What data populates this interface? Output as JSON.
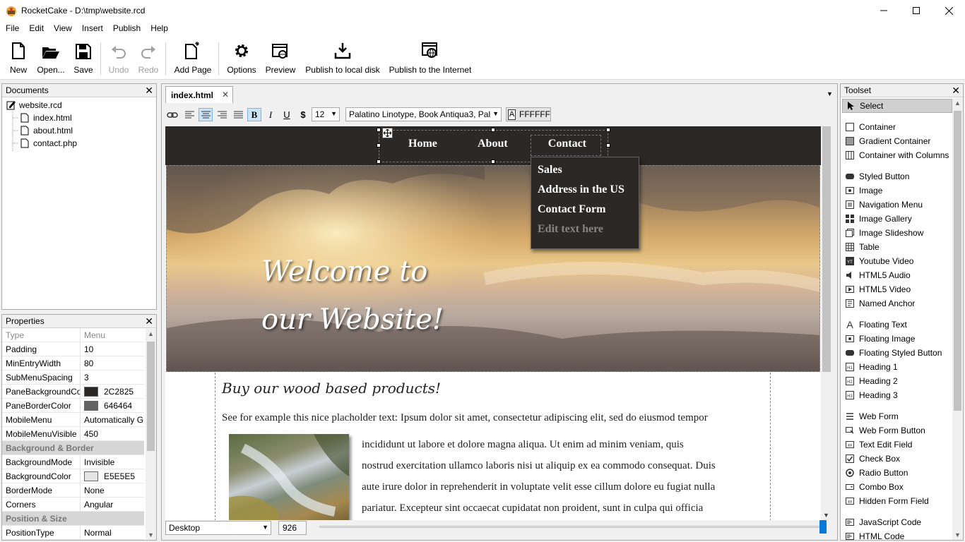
{
  "window": {
    "title": "RocketCake - D:\\tmp\\website.rcd",
    "minimize": "—",
    "maximize": "☐",
    "close": "✕"
  },
  "menu": [
    "File",
    "Edit",
    "View",
    "Insert",
    "Publish",
    "Help"
  ],
  "toolbar": {
    "new": "New",
    "open": "Open...",
    "save": "Save",
    "undo": "Undo",
    "redo": "Redo",
    "add_page": "Add Page",
    "options": "Options",
    "preview": "Preview",
    "publish_local": "Publish to local disk",
    "publish_internet": "Publish to the Internet"
  },
  "documents": {
    "title": "Documents",
    "close": "✕",
    "root": "website.rcd",
    "files": [
      "index.html",
      "about.html",
      "contact.php"
    ]
  },
  "properties": {
    "title": "Properties",
    "close": "✕",
    "rows": [
      {
        "k": "Type",
        "v": "Menu"
      },
      {
        "k": "Padding",
        "v": "10"
      },
      {
        "k": "MinEntryWidth",
        "v": "80"
      },
      {
        "k": "SubMenuSpacing",
        "v": "3"
      },
      {
        "k": "PaneBackgroundCo",
        "v": "2C2825"
      },
      {
        "k": "PaneBorderColor",
        "v": "646464"
      },
      {
        "k": "MobileMenu",
        "v": "Automatically G"
      },
      {
        "k": "MobileMenuVisible",
        "v": "450"
      },
      {
        "k": "Background & Border",
        "v": ""
      },
      {
        "k": "BackgroundMode",
        "v": "Invisible"
      },
      {
        "k": "BackgroundColor",
        "v": "E5E5E5"
      },
      {
        "k": "BorderMode",
        "v": "None"
      },
      {
        "k": "Corners",
        "v": "Angular"
      },
      {
        "k": "Position & Size",
        "v": ""
      },
      {
        "k": "PositionType",
        "v": "Normal"
      }
    ],
    "swatches": {
      "pane_bg": "#2c2825",
      "pane_border": "#646464",
      "bg": "#e5e5e5"
    }
  },
  "editor": {
    "tab": "index.html",
    "tab_close": "✕",
    "tabs_menu": "▼",
    "font_size": "12",
    "font_family": "Palatino Linotype, Book Antiqua3, Pal",
    "color_label": "A",
    "color_value": "FFFFFF",
    "device": "Desktop",
    "width": "926"
  },
  "page": {
    "nav": [
      "Home",
      "About",
      "Contact"
    ],
    "submenu": [
      "Sales",
      "Address in the US",
      "Contact Form",
      "Edit text here"
    ],
    "hero_line1": "Welcome to",
    "hero_line2": "our Website!",
    "heading": "Buy our wood based products!",
    "para_first": "See for example this nice placholder text: Ipsum dolor sit amet, consectetur adipiscing elit, sed do eiusmod tempor",
    "para_lines": [
      "incididunt ut labore et dolore magna aliqua. Ut enim ad minim veniam, quis",
      "nostrud exercitation ullamco laboris nisi ut aliquip ex ea commodo consequat. Duis",
      "aute irure dolor in reprehenderit in voluptate velit esse cillum dolore eu fugiat nulla",
      "pariatur. Excepteur sint occaecat cupidatat non proident, sunt in culpa qui officia"
    ],
    "header_color": "#2c2825"
  },
  "toolset": {
    "title": "Toolset",
    "close": "✕",
    "groups": [
      [
        {
          "name": "Select",
          "icon": "cursor-icon"
        }
      ],
      [
        {
          "name": "Container",
          "icon": "container-icon"
        },
        {
          "name": "Gradient Container",
          "icon": "gradient-icon"
        },
        {
          "name": "Container with Columns",
          "icon": "columns-icon"
        }
      ],
      [
        {
          "name": "Styled Button",
          "icon": "button-icon"
        },
        {
          "name": "Image",
          "icon": "image-icon"
        },
        {
          "name": "Navigation Menu",
          "icon": "menu-icon"
        },
        {
          "name": "Image Gallery",
          "icon": "gallery-icon"
        },
        {
          "name": "Image Slideshow",
          "icon": "slideshow-icon"
        },
        {
          "name": "Table",
          "icon": "table-icon"
        },
        {
          "name": "Youtube Video",
          "icon": "youtube-icon"
        },
        {
          "name": "HTML5 Audio",
          "icon": "audio-icon"
        },
        {
          "name": "HTML5 Video",
          "icon": "video-icon"
        },
        {
          "name": "Named Anchor",
          "icon": "anchor-icon"
        }
      ],
      [
        {
          "name": "Floating Text",
          "icon": "text-icon"
        },
        {
          "name": "Floating Image",
          "icon": "image-icon"
        },
        {
          "name": "Floating Styled Button",
          "icon": "button-icon"
        },
        {
          "name": "Heading 1",
          "icon": "h1-icon"
        },
        {
          "name": "Heading 2",
          "icon": "h2-icon"
        },
        {
          "name": "Heading 3",
          "icon": "h3-icon"
        }
      ],
      [
        {
          "name": "Web Form",
          "icon": "form-icon"
        },
        {
          "name": "Web Form Button",
          "icon": "form-button-icon"
        },
        {
          "name": "Text Edit Field",
          "icon": "textfield-icon"
        },
        {
          "name": "Check Box",
          "icon": "checkbox-icon"
        },
        {
          "name": "Radio Button",
          "icon": "radio-icon"
        },
        {
          "name": "Combo Box",
          "icon": "combobox-icon"
        },
        {
          "name": "Hidden Form Field",
          "icon": "hidden-field-icon"
        }
      ],
      [
        {
          "name": "JavaScript Code",
          "icon": "js-icon"
        },
        {
          "name": "HTML Code",
          "icon": "html-icon"
        }
      ]
    ]
  }
}
